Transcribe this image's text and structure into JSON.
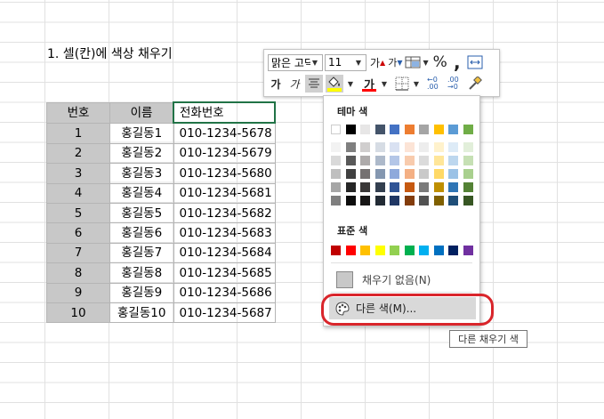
{
  "sheet": {
    "title": "1. 셀(칸)에 색상 채우기",
    "headers": [
      "번호",
      "이름",
      "전화번호"
    ],
    "rows": [
      [
        "1",
        "홍길동1",
        "010-1234-5678"
      ],
      [
        "2",
        "홍길동2",
        "010-1234-5679"
      ],
      [
        "3",
        "홍길동3",
        "010-1234-5680"
      ],
      [
        "4",
        "홍길동4",
        "010-1234-5681"
      ],
      [
        "5",
        "홍길동5",
        "010-1234-5682"
      ],
      [
        "6",
        "홍길동6",
        "010-1234-5683"
      ],
      [
        "7",
        "홍길동7",
        "010-1234-5684"
      ],
      [
        "8",
        "홍길동8",
        "010-1234-5685"
      ],
      [
        "9",
        "홍길동9",
        "010-1234-5686"
      ],
      [
        "10",
        "홍길동10",
        "010-1234-5687"
      ]
    ]
  },
  "toolbar": {
    "font_name": "맑은 고딕",
    "font_size": "11",
    "increase_font": "가",
    "decrease_font": "가",
    "percent": "%",
    "comma": ",",
    "bold": "가",
    "italic": "가",
    "font_color_letter": "가",
    "fill_color": "#ffff00",
    "font_color": "#ff0000",
    "increase_decimal": "←0 .00",
    "decrease_decimal": ".00 →0"
  },
  "palette": {
    "theme_label": "테마 색",
    "standard_label": "표준 색",
    "theme_colors": [
      [
        "#ffffff",
        "#f2f2f2",
        "#d9d9d9",
        "#bfbfbf",
        "#a6a6a6",
        "#7f7f7f"
      ],
      [
        "#000000",
        "#7f7f7f",
        "#595959",
        "#404040",
        "#262626",
        "#0d0d0d"
      ],
      [
        "#e7e6e6",
        "#d0cece",
        "#aeabab",
        "#757171",
        "#3a3838",
        "#171616"
      ],
      [
        "#44546a",
        "#d6dce4",
        "#adb9ca",
        "#8497b0",
        "#333f4f",
        "#222b35"
      ],
      [
        "#4472c4",
        "#d9e1f2",
        "#b4c6e7",
        "#8ea9db",
        "#305496",
        "#203764"
      ],
      [
        "#ed7d31",
        "#fce4d6",
        "#f8cbad",
        "#f4b084",
        "#c65911",
        "#833c0c"
      ],
      [
        "#a5a5a5",
        "#ededed",
        "#dbdbdb",
        "#c9c9c9",
        "#7b7b7b",
        "#525252"
      ],
      [
        "#ffc000",
        "#fff2cc",
        "#ffe699",
        "#ffd966",
        "#bf8f00",
        "#806000"
      ],
      [
        "#5b9bd5",
        "#ddebf7",
        "#bdd7ee",
        "#9bc2e6",
        "#2f75b5",
        "#1f4e78"
      ],
      [
        "#70ad47",
        "#e2efda",
        "#c6e0b4",
        "#a9d08e",
        "#548235",
        "#375623"
      ]
    ],
    "standard_colors": [
      "#c00000",
      "#ff0000",
      "#ffc000",
      "#ffff00",
      "#92d050",
      "#00b050",
      "#00b0f0",
      "#0070c0",
      "#002060",
      "#7030a0"
    ],
    "no_fill_label": "채우기 없음(N)",
    "more_colors_label": "다른 색(M)..."
  },
  "tooltip": {
    "text": "다른 채우기 색"
  }
}
